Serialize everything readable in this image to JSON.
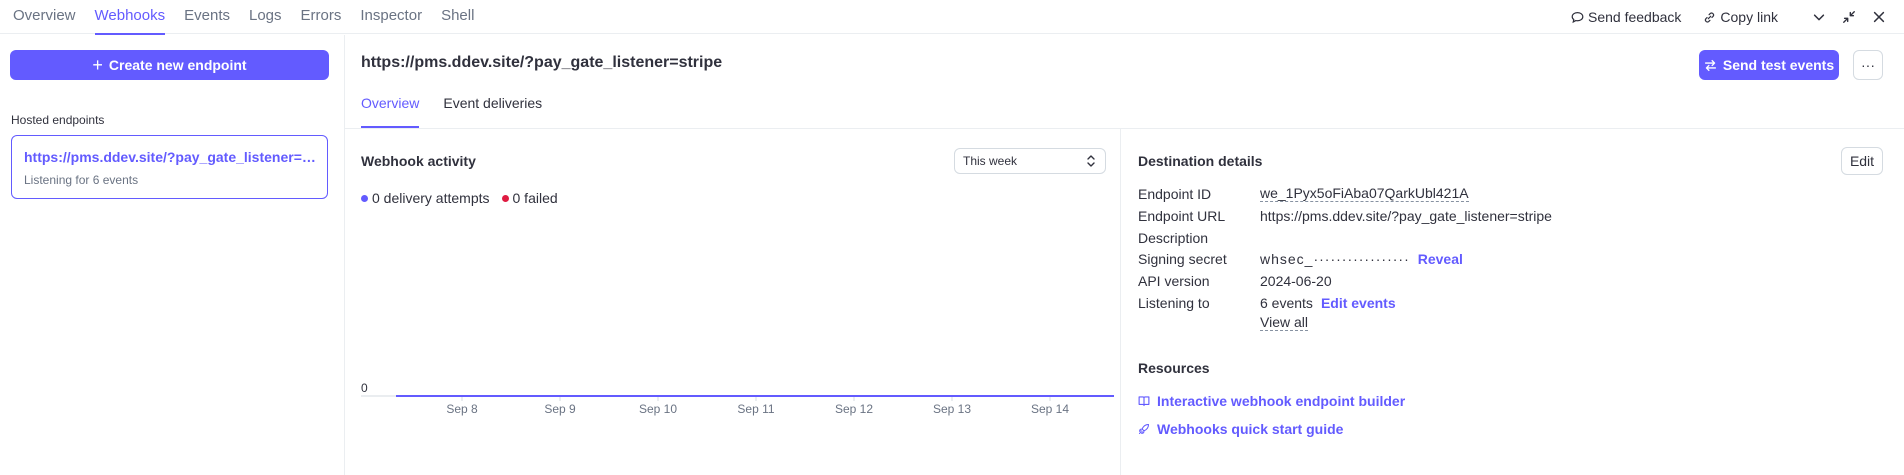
{
  "nav": {
    "tabs": [
      {
        "label": "Overview"
      },
      {
        "label": "Webhooks",
        "active": true
      },
      {
        "label": "Events"
      },
      {
        "label": "Logs"
      },
      {
        "label": "Errors"
      },
      {
        "label": "Inspector"
      },
      {
        "label": "Shell"
      }
    ],
    "send_feedback": "Send feedback",
    "copy_link": "Copy link"
  },
  "sidebar": {
    "create_button": "Create new endpoint",
    "hosted_label": "Hosted endpoints",
    "endpoint": {
      "url": "https://pms.ddev.site/?pay_gate_listener=stripe",
      "subtitle": "Listening for 6 events"
    }
  },
  "header": {
    "title": "https://pms.ddev.site/?pay_gate_listener=stripe",
    "send_test": "Send test events",
    "more": "···",
    "subtabs": [
      {
        "label": "Overview",
        "active": true
      },
      {
        "label": "Event deliveries"
      }
    ]
  },
  "activity": {
    "title": "Webhook activity",
    "range": "This week",
    "legend": [
      {
        "label": "0 delivery attempts",
        "color": "#635bff"
      },
      {
        "label": "0 failed",
        "color": "#df1b41"
      }
    ]
  },
  "chart_data": {
    "type": "line",
    "x": [
      "Sep 8",
      "Sep 9",
      "Sep 10",
      "Sep 11",
      "Sep 12",
      "Sep 13",
      "Sep 14"
    ],
    "series": [
      {
        "values": [
          0,
          0,
          0,
          0,
          0,
          0,
          0
        ],
        "color": "#635bff"
      }
    ],
    "y_ticks": [
      "0"
    ],
    "ylim": [
      0,
      1
    ]
  },
  "details": {
    "title": "Destination details",
    "edit": "Edit",
    "rows": {
      "endpoint_id": {
        "label": "Endpoint ID",
        "value": "we_1Pyx5oFiAba07QarkUbl421A"
      },
      "endpoint_url": {
        "label": "Endpoint URL",
        "value": "https://pms.ddev.site/?pay_gate_listener=stripe"
      },
      "description": {
        "label": "Description",
        "value": ""
      },
      "signing_secret": {
        "label": "Signing secret",
        "value": "whsec_·················",
        "action": "Reveal"
      },
      "api_version": {
        "label": "API version",
        "value": "2024-06-20"
      },
      "listening_to": {
        "label": "Listening to",
        "value": "6 events",
        "action": "Edit events",
        "view_all": "View all"
      }
    },
    "resources": {
      "title": "Resources",
      "links": [
        {
          "label": "Interactive webhook endpoint builder",
          "icon": "book-icon"
        },
        {
          "label": "Webhooks quick start guide",
          "icon": "rocket-icon"
        }
      ]
    }
  }
}
